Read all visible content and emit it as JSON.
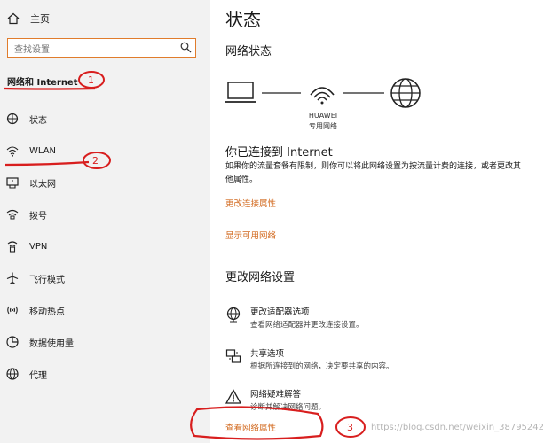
{
  "sidebar": {
    "home_label": "主页",
    "search_placeholder": "查找设置",
    "section_title": "网络和 Internet",
    "items": [
      {
        "label": "状态",
        "icon": "home-network-icon"
      },
      {
        "label": "WLAN",
        "icon": "wifi-icon"
      },
      {
        "label": "以太网",
        "icon": "ethernet-icon"
      },
      {
        "label": "拨号",
        "icon": "dialup-icon"
      },
      {
        "label": "VPN",
        "icon": "vpn-icon"
      },
      {
        "label": "飞行模式",
        "icon": "airplane-icon"
      },
      {
        "label": "移动热点",
        "icon": "hotspot-icon"
      },
      {
        "label": "数据使用量",
        "icon": "data-usage-icon"
      },
      {
        "label": "代理",
        "icon": "globe-icon"
      }
    ]
  },
  "annotations": {
    "n1": "1",
    "n2": "2",
    "n3": "3",
    "color": "#d81e1e"
  },
  "main": {
    "title": "状态",
    "network_status_heading": "网络状态",
    "device": {
      "name": "HUAWEI",
      "type": "专用网络"
    },
    "connected_text": "你已连接到 Internet",
    "description": "如果你的流量套餐有限制，则你可以将此网络设置为按流量计费的连接，或者更改其他属性。",
    "change_connection_link": "更改连接属性",
    "show_networks_link": "显示可用网络",
    "change_settings_heading": "更改网络设置",
    "options": [
      {
        "title": "更改适配器选项",
        "desc": "查看网络适配器并更改连接设置。",
        "icon": "adapter-icon"
      },
      {
        "title": "共享选项",
        "desc": "根据所连接到的网络，决定要共享的内容。",
        "icon": "sharing-icon"
      },
      {
        "title": "网络疑难解答",
        "desc": "诊断并解决网络问题。",
        "icon": "warning-icon"
      }
    ],
    "view_properties_link": "查看网络属性",
    "link_color": "#d2691e"
  },
  "watermark": "https://blog.csdn.net/weixin_38795242"
}
